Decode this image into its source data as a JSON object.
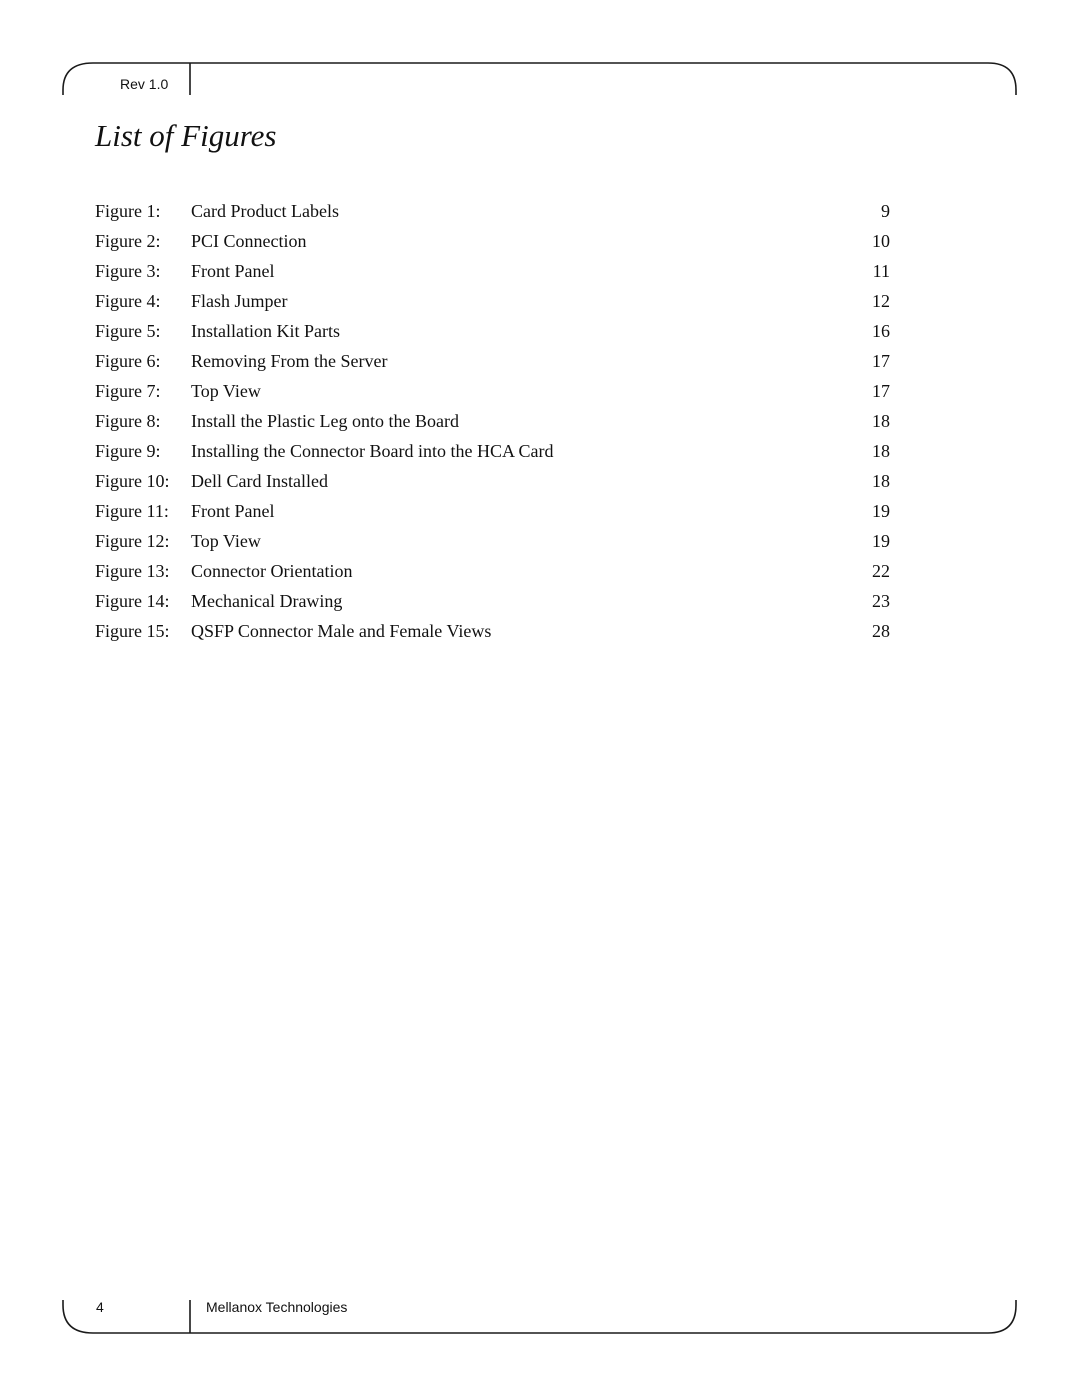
{
  "header": {
    "revision": "Rev 1.0"
  },
  "page_title": "List of Figures",
  "figures": [
    {
      "number": "Figure 1:",
      "title": "Card Product Labels",
      "page": "9"
    },
    {
      "number": "Figure 2:",
      "title": "PCI Connection",
      "page": "10"
    },
    {
      "number": "Figure 3:",
      "title": "Front Panel",
      "page": "11"
    },
    {
      "number": "Figure 4:",
      "title": "Flash Jumper",
      "page": "12"
    },
    {
      "number": "Figure 5:",
      "title": "Installation Kit Parts",
      "page": "16"
    },
    {
      "number": "Figure 6:",
      "title": "Removing From the Server",
      "page": "17"
    },
    {
      "number": "Figure 7:",
      "title": "Top View",
      "page": "17"
    },
    {
      "number": "Figure 8:",
      "title": "Install the Plastic Leg onto the Board",
      "page": "18"
    },
    {
      "number": "Figure 9:",
      "title": "Installing the Connector Board into the HCA Card",
      "page": "18"
    },
    {
      "number": "Figure 10:",
      "title": "Dell Card Installed",
      "page": "18"
    },
    {
      "number": "Figure 11:",
      "title": "Front Panel",
      "page": "19"
    },
    {
      "number": "Figure 12:",
      "title": "Top View",
      "page": "19"
    },
    {
      "number": "Figure 13:",
      "title": "Connector Orientation",
      "page": "22"
    },
    {
      "number": "Figure 14:",
      "title": "Mechanical Drawing",
      "page": "23"
    },
    {
      "number": "Figure 15:",
      "title": "QSFP Connector Male and Female Views",
      "page": "28"
    }
  ],
  "footer": {
    "page_number": "4",
    "company": "Mellanox Technologies"
  }
}
